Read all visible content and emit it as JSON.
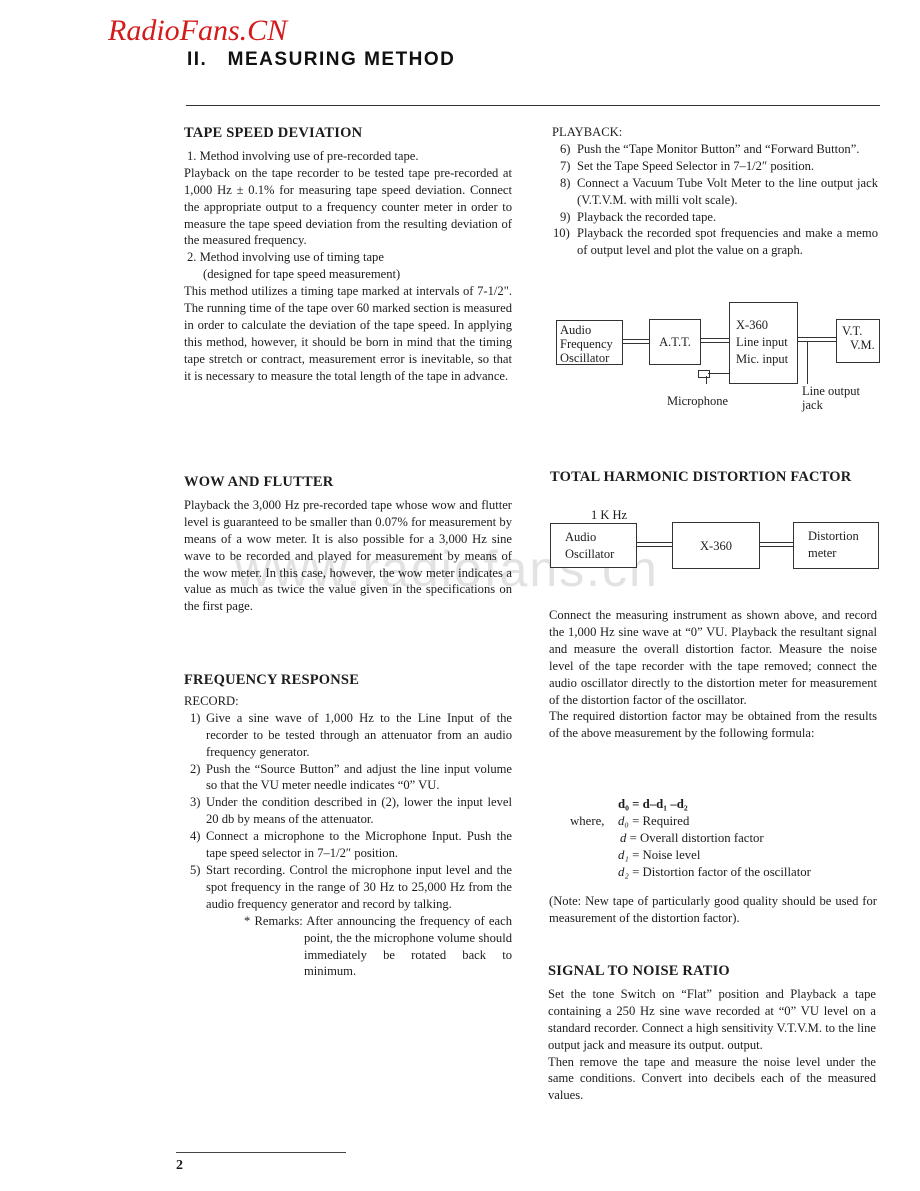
{
  "header": {
    "brand": "RadioFans.CN",
    "chapter_title": "II.   MEASURING METHOD"
  },
  "watermark": "www.radiofans.cn",
  "left_column": {
    "tape_speed": {
      "heading": "TAPE SPEED DEVIATION",
      "method1_title": "1.  Method involving use of pre-recorded tape.",
      "method1_body": "Playback on the tape recorder to be tested tape pre-recorded at 1,000 Hz ± 0.1% for measuring tape speed deviation. Connect the appropriate output to a frequency counter meter in order to measure the tape speed deviation from the resulting deviation of the measured frequency.",
      "method2_title": "2.  Method involving use of timing tape",
      "method2_subtitle": "(designed for tape speed measurement)",
      "method2_body": "This method utilizes a timing tape marked at intervals of 7-1/2\". The running time of the tape over 60 marked section is measured in order to calculate the deviation of the tape speed. In applying this method, however, it should be born in mind that the timing tape stretch or contract, measurement error is inevitable, so that it is necessary to measure the total length of the tape in advance."
    },
    "wow_flutter": {
      "heading": "WOW AND FLUTTER",
      "body": "Playback the 3,000 Hz pre-recorded tape whose wow and flutter level is guaranteed to be smaller than 0.07% for measurement by means of a wow meter. It is also possible for a 3,000 Hz sine wave to be recorded and played for measurement by means of the wow meter. In this case, however, the wow meter indicates a value as much as twice the value given in the specifications on the first page."
    },
    "frequency_response": {
      "heading": "FREQUENCY RESPONSE",
      "record_label": "RECORD:",
      "steps": [
        {
          "num": "1)",
          "text": "Give a sine wave of 1,000 Hz to the Line Input of the recorder to be tested through an attenuator from an audio frequency generator."
        },
        {
          "num": "2)",
          "text": "Push the “Source Button” and adjust the line input volume so that the VU meter needle indicates “0” VU."
        },
        {
          "num": "3)",
          "text": "Under the condition described in (2), lower the input level 20 db by means of the attenuator."
        },
        {
          "num": "4)",
          "text": "Connect a microphone to the Microphone Input. Push the tape speed selector in 7–1/2″ position."
        },
        {
          "num": "5)",
          "text": "Start recording. Control the microphone input level and the spot frequency in the range of 30 Hz to 25,000 Hz from the audio frequency generator and record by talking."
        }
      ],
      "remark": "* Remarks: After announcing the frequency of each point, the the microphone volume should immediately be rotated back to minimum."
    }
  },
  "right_column": {
    "playback": {
      "label": "PLAYBACK:",
      "steps": [
        {
          "num": "6)",
          "text": "Push the “Tape Monitor Button” and “Forward Button”."
        },
        {
          "num": "7)",
          "text": "Set the Tape Speed Selector in 7–1/2″ position."
        },
        {
          "num": "8)",
          "text": "Connect a Vacuum Tube Volt Meter to the line output jack (V.T.V.M. with milli volt scale)."
        },
        {
          "num": "9)",
          "text": "Playback the recorded tape."
        },
        {
          "num": "10)",
          "text": "Playback the recorded spot frequencies and make a memo of output level and plot the value on a graph."
        }
      ]
    },
    "diagram1": {
      "osc_line1": "Audio",
      "osc_line2": "Frequency",
      "osc_line3": "Oscillator",
      "att": "A.T.T.",
      "dut_line1": "X-360",
      "dut_line2": "Line input",
      "dut_line3": "Mic. input",
      "vtvm_line1": "V.T.",
      "vtvm_line2": "V.M.",
      "microphone": "Microphone",
      "line_out1": "Line output",
      "line_out2": "jack"
    },
    "thd": {
      "heading": "TOTAL HARMONIC DISTORTION FACTOR",
      "diagram": {
        "freq": "1 K Hz",
        "osc_line1": "Audio",
        "osc_line2": "Oscillator",
        "dut": "X-360",
        "meter_line1": "Distortion",
        "meter_line2": "meter"
      },
      "body1": "Connect the measuring instrument as shown above, and record the 1,000 Hz sine wave at “0” VU. Playback the resultant signal and measure the overall distortion factor. Measure the noise level of the tape recorder with the tape removed; connect the audio oscillator directly to the distortion meter for measurement of the distortion factor of the oscillator.",
      "body2": "The required distortion factor may be obtained from the results of the above measurement by the following formula:",
      "formula": {
        "equation": "d₀ = d–d₁ –d₂",
        "where": "where,",
        "defs": [
          {
            "sym": "d₀",
            "desc": "= Required"
          },
          {
            "sym": "d",
            "desc": " = Overall distortion factor"
          },
          {
            "sym": "d₁",
            "desc": "= Noise level"
          },
          {
            "sym": "d₂",
            "desc": "= Distortion factor of the oscillator"
          }
        ]
      },
      "note": "(Note: New tape of particularly good quality should be used for measurement of the distortion factor)."
    },
    "snr": {
      "heading": "SIGNAL TO NOISE RATIO",
      "body1": "Set the tone Switch on “Flat” position and Playback a tape containing a 250 Hz sine wave recorded at “0” VU level on a standard recorder. Connect a high sensitivity V.T.V.M. to the line output jack and measure its output. output.",
      "body2": "Then remove the tape and measure the noise level under the same conditions. Convert into decibels each of the measured values."
    }
  },
  "footer": {
    "page_number": "2"
  }
}
